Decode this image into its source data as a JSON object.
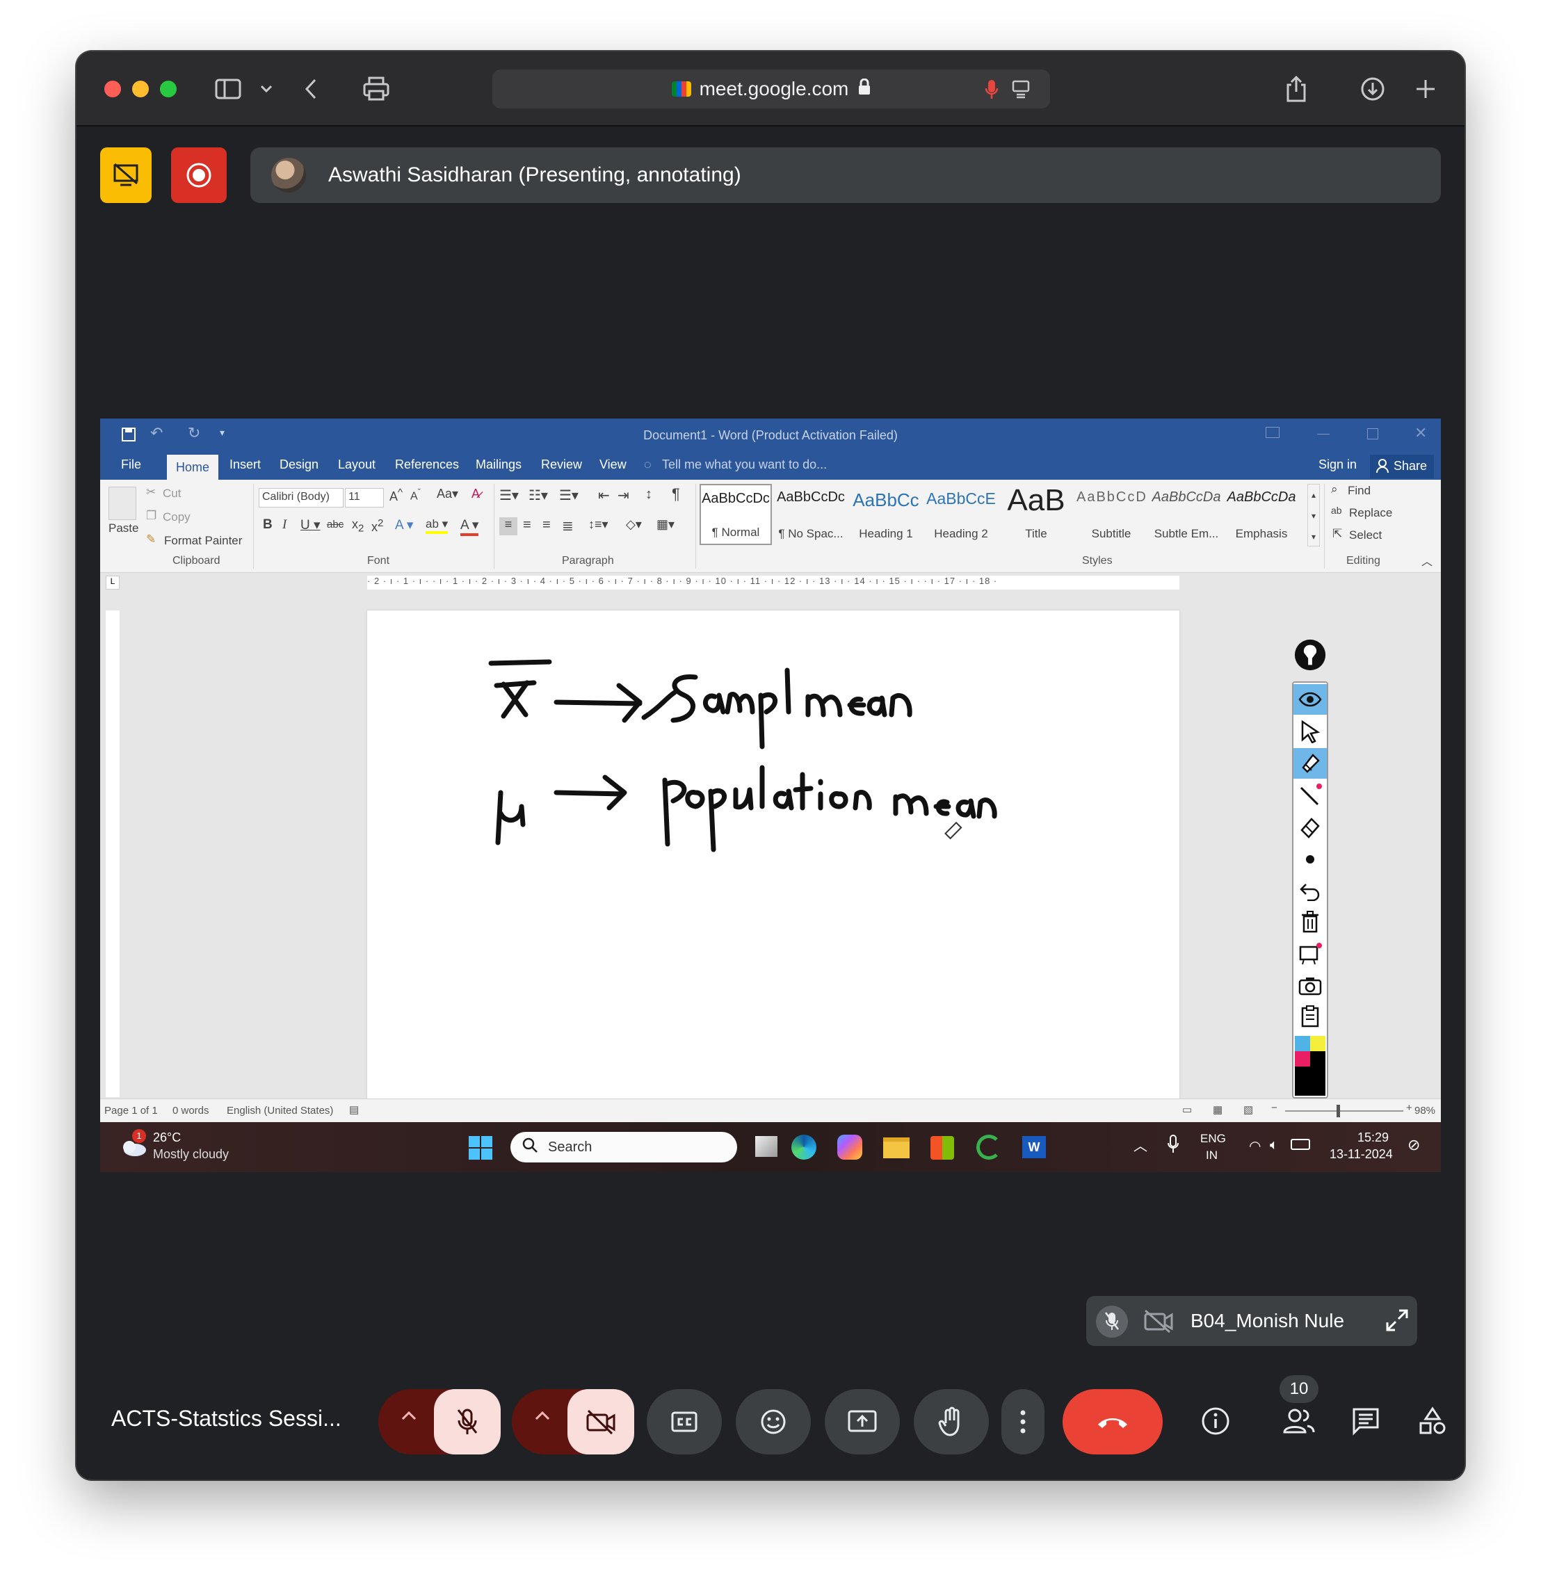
{
  "browser": {
    "url": "meet.google.com"
  },
  "meet": {
    "presenter_text": "Aswathi Sasidharan (Presenting, annotating)",
    "meeting_title": "ACTS-Statstics Sessi...",
    "participant_name": "B04_Monish Nule",
    "people_count": "10"
  },
  "word": {
    "title": "Document1 - Word (Product Activation Failed)",
    "tabs": [
      "File",
      "Home",
      "Insert",
      "Design",
      "Layout",
      "References",
      "Mailings",
      "Review",
      "View"
    ],
    "tell_me": "Tell me what you want to do...",
    "sign_in": "Sign in",
    "share": "Share",
    "clipboard": {
      "paste": "Paste",
      "cut": "Cut",
      "copy": "Copy",
      "format_painter": "Format Painter",
      "label": "Clipboard"
    },
    "font": {
      "family": "Calibri (Body)",
      "size": "11",
      "label": "Font"
    },
    "paragraph_label": "Paragraph",
    "styles_label": "Styles",
    "styles": [
      {
        "preview": "AaBbCcDc",
        "name": "¶ Normal"
      },
      {
        "preview": "AaBbCcDc",
        "name": "¶ No Spac..."
      },
      {
        "preview": "AaBbCc",
        "name": "Heading 1"
      },
      {
        "preview": "AaBbCcE",
        "name": "Heading 2"
      },
      {
        "preview": "AaB",
        "name": "Title"
      },
      {
        "preview": "AaBbCcD",
        "name": "Subtitle"
      },
      {
        "preview": "AaBbCcDa",
        "name": "Subtle Em..."
      },
      {
        "preview": "AaBbCcDa",
        "name": "Emphasis"
      }
    ],
    "editing": {
      "find": "Find",
      "replace": "Replace",
      "select": "Select",
      "label": "Editing"
    },
    "ruler": "· 2 · ı · 1 · ı ·   · ı · 1 · ı · 2 · ı · 3 · ı · 4 · ı · 5 · ı · 6 · ı · 7 · ı · 8 · ı · 9 · ı · 10 · ı · 11 · ı · 12 · ı · 13 · ı · 14 · ı · 15 · ı ·   · ı · 17 · ı · 18 ·",
    "status": {
      "page": "Page 1 of 1",
      "words": "0 words",
      "language": "English (United States)",
      "zoom": "98%"
    }
  },
  "annotation_text": {
    "line1_symbol": "x̄",
    "line1_text": "Sampl mean",
    "line2_symbol": "μ",
    "line2_text": "population mean"
  },
  "taskbar": {
    "weather_temp": "26°C",
    "weather_desc": "Mostly cloudy",
    "weather_badge": "1",
    "search": "Search",
    "lang1": "ENG",
    "lang2": "IN",
    "time": "15:29",
    "date": "13-11-2024"
  },
  "colors": {
    "word_blue": "#2b579a",
    "meet_red": "#ea4335",
    "present_yellow": "#fbbc04",
    "end_call": "#ea4335"
  }
}
